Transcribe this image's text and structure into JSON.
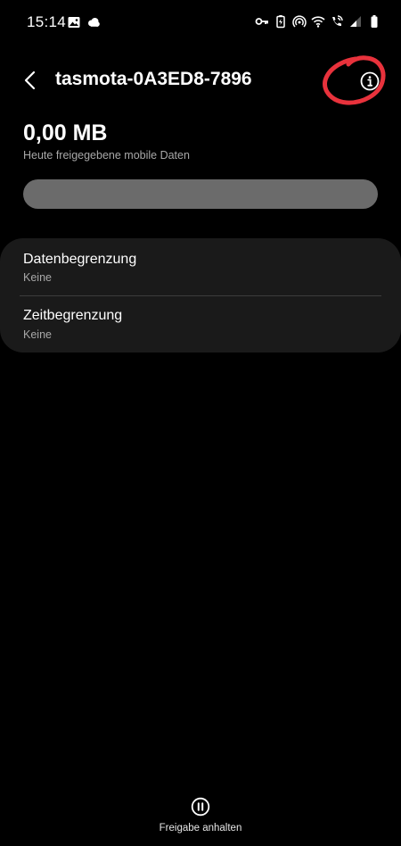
{
  "status_bar": {
    "time": "15:14",
    "left_icons": [
      "image-icon",
      "cloud-icon"
    ],
    "right_icons": [
      "key-icon",
      "battery-saver-icon",
      "hotspot-icon",
      "wifi-icon",
      "wifi-calling-icon",
      "signal-icon",
      "battery-icon"
    ]
  },
  "header": {
    "title": "tasmota-0A3ED8-7896",
    "back_icon": "chevron-left-icon",
    "info_icon": "info-icon"
  },
  "usage": {
    "value": "0,00 MB",
    "caption": "Heute freigegebene mobile Daten",
    "progress_fraction": 0
  },
  "limits": {
    "items": [
      {
        "title": "Datenbegrenzung",
        "value": "Keine"
      },
      {
        "title": "Zeitbegrenzung",
        "value": "Keine"
      }
    ]
  },
  "footer": {
    "action_label": "Freigabe anhalten",
    "action_icon": "pause-circle-icon"
  },
  "colors": {
    "background": "#000000",
    "card": "#1a1a1a",
    "progress_track": "#6b6b6b",
    "secondary_text": "#a8a8a8",
    "annotation": "#e8323c"
  }
}
